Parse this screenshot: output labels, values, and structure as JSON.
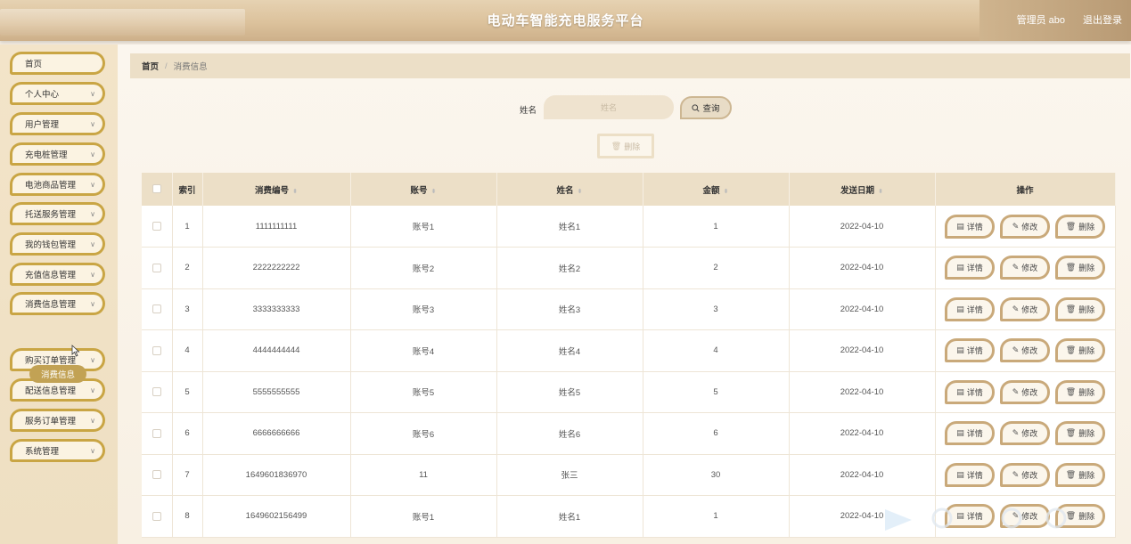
{
  "header": {
    "title": "电动车智能充电服务平台",
    "user": "管理员 abo",
    "logout": "退出登录"
  },
  "sidebar": {
    "items": [
      {
        "label": "首页",
        "has_children": false
      },
      {
        "label": "个人中心",
        "has_children": true
      },
      {
        "label": "用户管理",
        "has_children": true
      },
      {
        "label": "充电桩管理",
        "has_children": true
      },
      {
        "label": "电池商品管理",
        "has_children": true
      },
      {
        "label": "托送服务管理",
        "has_children": true
      },
      {
        "label": "我的钱包管理",
        "has_children": true
      },
      {
        "label": "充值信息管理",
        "has_children": true
      },
      {
        "label": "消费信息管理",
        "has_children": true
      },
      {
        "label": "购买订单管理",
        "has_children": true
      },
      {
        "label": "配送信息管理",
        "has_children": true
      },
      {
        "label": "服务订单管理",
        "has_children": true
      },
      {
        "label": "系统管理",
        "has_children": true
      }
    ],
    "active_sub": "消费信息"
  },
  "breadcrumb": {
    "home": "首页",
    "sep": "/",
    "current": "消费信息"
  },
  "search": {
    "label": "姓名",
    "placeholder": "姓名",
    "button": "查询"
  },
  "actions": {
    "delete": "删除"
  },
  "table": {
    "headers": {
      "index": "索引",
      "consume_no": "消费编号",
      "account": "账号",
      "name": "姓名",
      "amount": "金额",
      "date": "发送日期",
      "ops": "操作"
    },
    "op_labels": {
      "detail": "详情",
      "edit": "修改",
      "delete": "删除"
    },
    "rows": [
      {
        "index": "1",
        "consume_no": "1111111111",
        "account": "账号1",
        "name": "姓名1",
        "amount": "1",
        "date": "2022-04-10"
      },
      {
        "index": "2",
        "consume_no": "2222222222",
        "account": "账号2",
        "name": "姓名2",
        "amount": "2",
        "date": "2022-04-10"
      },
      {
        "index": "3",
        "consume_no": "3333333333",
        "account": "账号3",
        "name": "姓名3",
        "amount": "3",
        "date": "2022-04-10"
      },
      {
        "index": "4",
        "consume_no": "4444444444",
        "account": "账号4",
        "name": "姓名4",
        "amount": "4",
        "date": "2022-04-10"
      },
      {
        "index": "5",
        "consume_no": "5555555555",
        "account": "账号5",
        "name": "姓名5",
        "amount": "5",
        "date": "2022-04-10"
      },
      {
        "index": "6",
        "consume_no": "6666666666",
        "account": "账号6",
        "name": "姓名6",
        "amount": "6",
        "date": "2022-04-10"
      },
      {
        "index": "7",
        "consume_no": "1649601836970",
        "account": "11",
        "name": "张三",
        "amount": "30",
        "date": "2022-04-10"
      },
      {
        "index": "8",
        "consume_no": "1649602156499",
        "account": "账号1",
        "name": "姓名1",
        "amount": "1",
        "date": "2022-04-10"
      }
    ]
  },
  "colors": {
    "accent": "#c9a544",
    "header": "#dcc29c",
    "active_sub": "#c2a254"
  }
}
